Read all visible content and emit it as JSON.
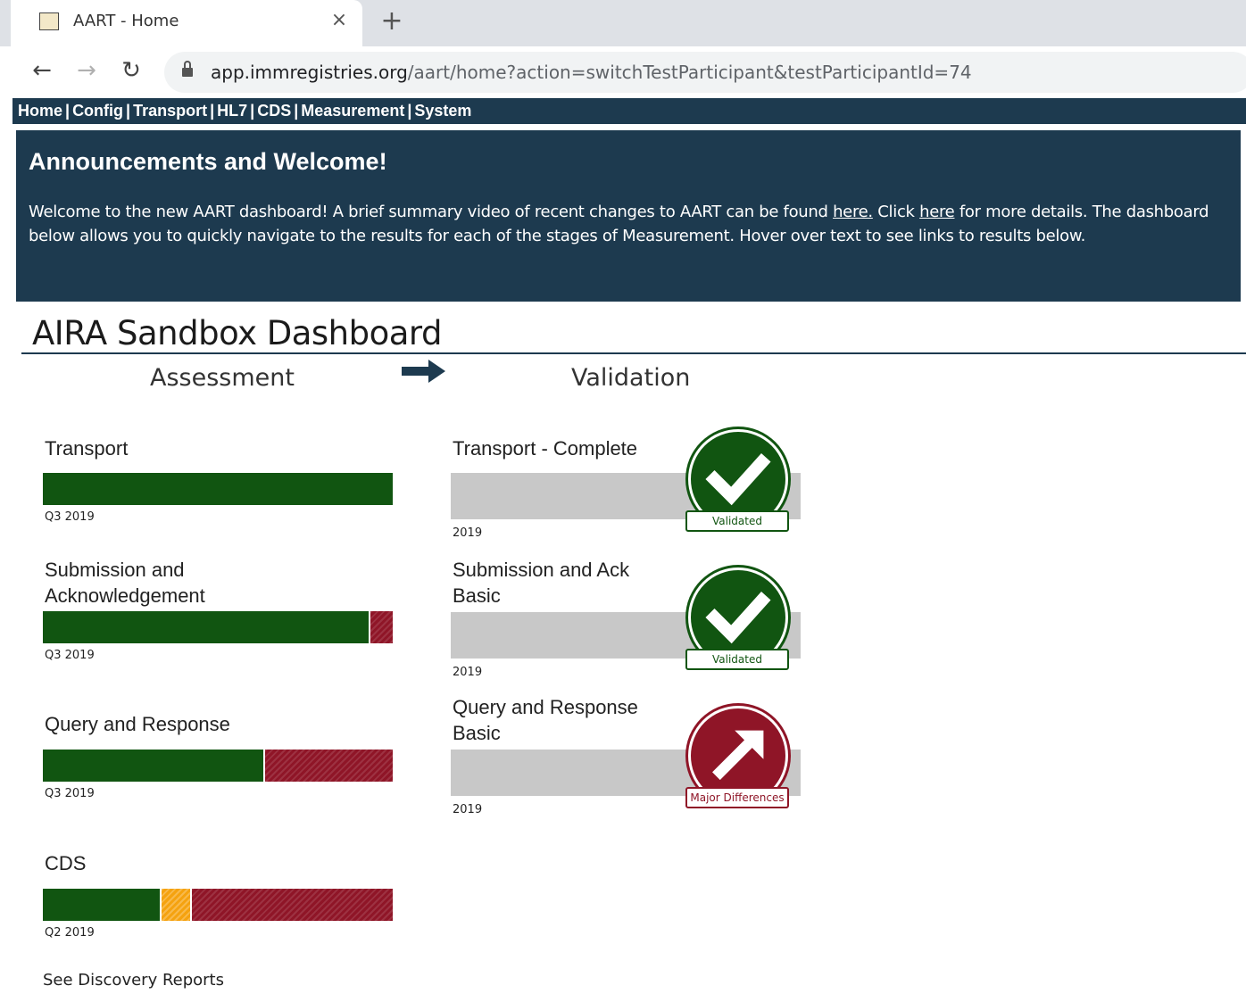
{
  "browser": {
    "tab_title": "AART - Home",
    "tab_close": "×",
    "new_tab": "+",
    "url_host": "app.immregistries.org",
    "url_path": "/aart/home?action=switchTestParticipant&testParticipantId=74"
  },
  "nav": {
    "items": [
      "Home",
      "Config",
      "Transport",
      "HL7",
      "CDS",
      "Measurement",
      "System"
    ],
    "separator": "|"
  },
  "announcement": {
    "title": "Announcements and Welcome!",
    "text_1": "Welcome to the new AART dashboard! A brief summary video of recent changes to AART can be found ",
    "link_1": "here.",
    "text_2": " Click ",
    "link_2": "here",
    "text_3": " for more details. The dashboard below allows you to quickly navigate to the results for each of the stages of Measurement. Hover over text to see links to results below."
  },
  "dashboard": {
    "title": "AIRA Sandbox Dashboard",
    "assessment_heading": "Assessment",
    "validation_heading": "Validation",
    "assessment": [
      {
        "label": "Transport",
        "quarter": "Q3 2019",
        "segments": [
          {
            "color": "green",
            "fraction": 1.0
          }
        ]
      },
      {
        "label": "Submission and Acknowledgement",
        "quarter": "Q3 2019",
        "segments": [
          {
            "color": "green",
            "fraction": 0.93
          },
          {
            "color": "red",
            "fraction": 0.07
          }
        ]
      },
      {
        "label": "Query and Response",
        "quarter": "Q3 2019",
        "segments": [
          {
            "color": "green",
            "fraction": 0.63
          },
          {
            "color": "red",
            "fraction": 0.37
          }
        ]
      },
      {
        "label": "CDS",
        "quarter": "Q2 2019",
        "segments": [
          {
            "color": "green",
            "fraction": 0.335
          },
          {
            "color": "orange",
            "fraction": 0.085
          },
          {
            "color": "red",
            "fraction": 0.58
          }
        ]
      }
    ],
    "validation": [
      {
        "label": "Transport - Complete",
        "year": "2019",
        "status": "Validated",
        "icon": "checkmark-icon",
        "status_color": "#115511"
      },
      {
        "label": "Submission and Ack Basic",
        "year": "2019",
        "status": "Validated",
        "icon": "checkmark-icon",
        "status_color": "#115511"
      },
      {
        "label": "Query and Response Basic",
        "year": "2019",
        "status": "Major Differences",
        "icon": "arrow-up-right-icon",
        "status_color": "#8f1527"
      }
    ],
    "discovery_link": "See Discovery Reports"
  }
}
